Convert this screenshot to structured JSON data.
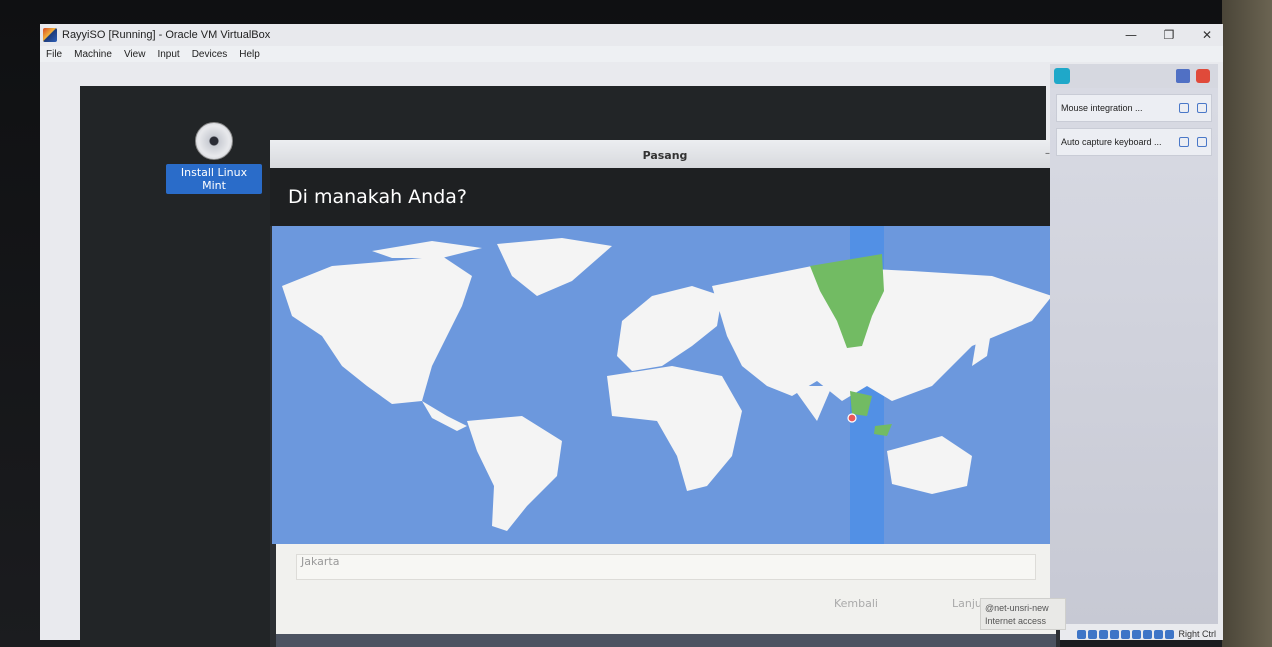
{
  "window": {
    "title": "RayyiSO [Running] - Oracle VM VirtualBox",
    "controls": {
      "minimize": "—",
      "restore": "❐",
      "close": "✕"
    }
  },
  "menubar": {
    "items": [
      {
        "label": "File"
      },
      {
        "label": "Machine"
      },
      {
        "label": "View"
      },
      {
        "label": "Input"
      },
      {
        "label": "Devices"
      },
      {
        "label": "Help"
      }
    ]
  },
  "desktop": {
    "icon_label": "Install Linux Mint"
  },
  "installer": {
    "window_title": "Pasang",
    "minimize": "–",
    "heading": "Di manakah Anda?",
    "timezone_value": "Jakarta",
    "back_label": "Kembali",
    "next_label": "Lanjutkan",
    "colors": {
      "ocean": "#6c98dd",
      "land": "#f4f4f4",
      "selected_zone": "#72bb63",
      "zone_band": "#4d8ee6"
    }
  },
  "sidebar": {
    "notifications": [
      {
        "label": "Mouse integration ..."
      },
      {
        "label": "Auto capture keyboard ..."
      }
    ]
  },
  "statusbar": {
    "host_key": "Right Ctrl"
  },
  "network_toast": {
    "ssid": "@net-unsri-new",
    "status": "Internet access"
  }
}
